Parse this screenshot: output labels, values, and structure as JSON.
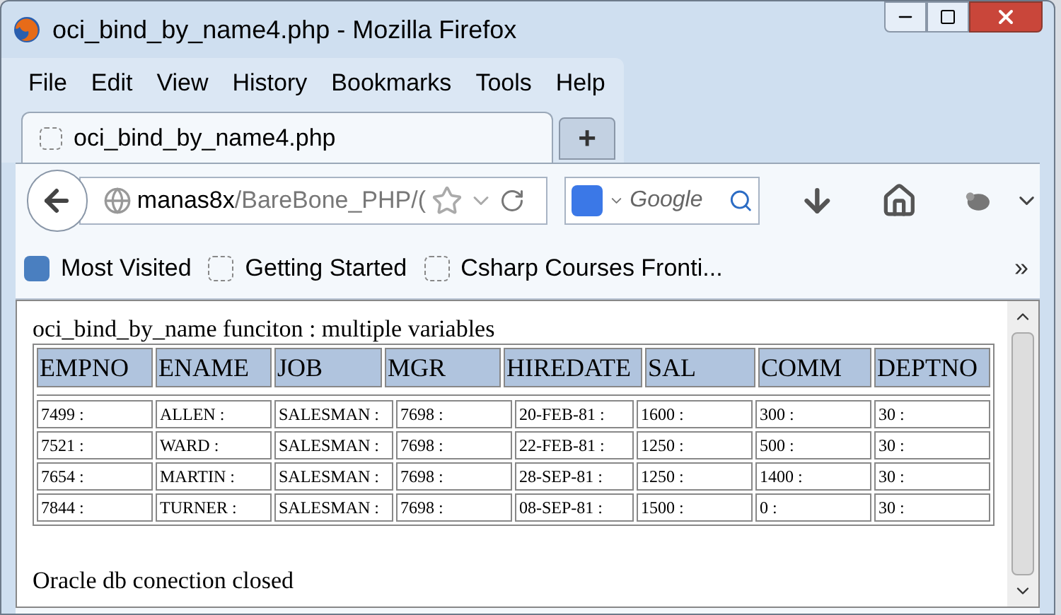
{
  "window": {
    "title": "oci_bind_by_name4.php - Mozilla Firefox"
  },
  "menu": [
    "File",
    "Edit",
    "View",
    "History",
    "Bookmarks",
    "Tools",
    "Help"
  ],
  "tabs": [
    {
      "label": "oci_bind_by_name4.php",
      "selected": true
    }
  ],
  "new_tab": "+",
  "address": {
    "host": "manas8x",
    "path": "/BareBone_PHP/("
  },
  "search": {
    "placeholder": "Google"
  },
  "bookmarks": [
    "Most Visited",
    "Getting Started",
    "Csharp Courses Fronti..."
  ],
  "bookmarks_overflow": "»",
  "page": {
    "heading": "oci_bind_by_name funciton : multiple variables",
    "table": {
      "columns": [
        "EMPNO",
        "ENAME",
        "JOB",
        "MGR",
        "HIREDATE",
        "SAL",
        "COMM",
        "DEPTNO"
      ],
      "rows": [
        [
          "7499 :",
          "ALLEN :",
          "SALESMAN :",
          "7698 :",
          "20-FEB-81 :",
          "1600 :",
          "300 :",
          "30 :"
        ],
        [
          "7521 :",
          "WARD :",
          "SALESMAN :",
          "7698 :",
          "22-FEB-81 :",
          "1250 :",
          "500 :",
          "30 :"
        ],
        [
          "7654 :",
          "MARTIN :",
          "SALESMAN :",
          "7698 :",
          "28-SEP-81 :",
          "1250 :",
          "1400 :",
          "30 :"
        ],
        [
          "7844 :",
          "TURNER :",
          "SALESMAN :",
          "7698 :",
          "08-SEP-81 :",
          "1500 :",
          "0 :",
          "30 :"
        ]
      ]
    },
    "footer": "Oracle db conection closed"
  }
}
